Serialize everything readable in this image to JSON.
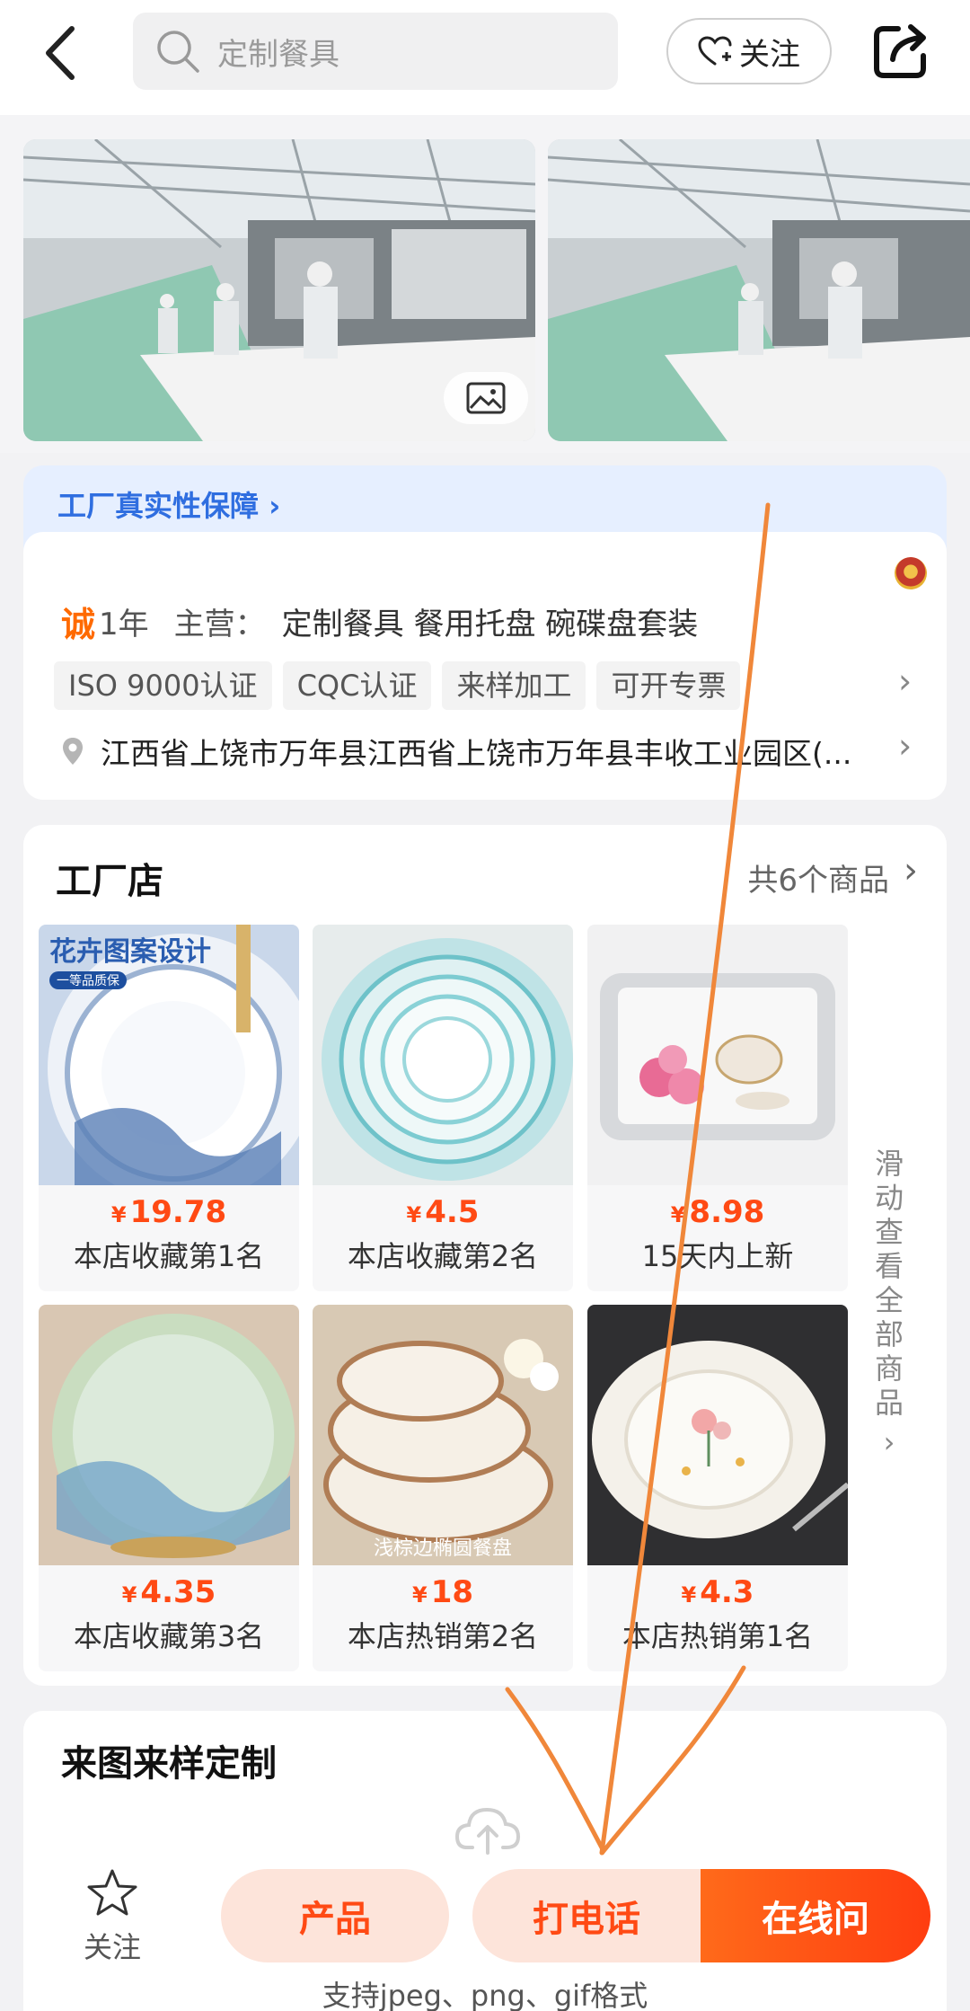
{
  "header": {
    "search_placeholder": "定制餐具",
    "follow_label": "关注"
  },
  "guarantee": {
    "label": "工厂真实性保障 ›"
  },
  "supplier": {
    "cheng": "诚",
    "years": "1年",
    "main_label": "主营：",
    "main_value": "定制餐具 餐用托盘 碗碟盘套装",
    "tags": [
      "ISO 9000认证",
      "CQC认证",
      "来样加工",
      "可开专票"
    ],
    "address": "江西省上饶市万年县江西省上饶市万年县丰收工业园区(..."
  },
  "store": {
    "title": "工厂店",
    "count": "共6个商品",
    "scroll_hint": "滑动查看全部商品",
    "products": [
      {
        "price": "19.78",
        "rank": "本店收藏第1名",
        "img_title": "花卉图案设计",
        "img_badge": "一等品质保"
      },
      {
        "price": "4.5",
        "rank": "本店收藏第2名"
      },
      {
        "price": "8.98",
        "rank": "15天内上新"
      },
      {
        "price": "4.35",
        "rank": "本店收藏第3名"
      },
      {
        "price": "18",
        "rank": "本店热销第2名",
        "img_caption": "浅棕边椭圆餐盘"
      },
      {
        "price": "4.3",
        "rank": "本店热销第1名"
      }
    ],
    "currency": "¥"
  },
  "custom": {
    "title": "来图来样定制",
    "formats": "支持jpeg、png、gif格式"
  },
  "bottom_bar": {
    "follow_label": "关注",
    "product_label": "产品",
    "call_label": "打电话",
    "online_label": "在线问"
  },
  "colors": {
    "accent": "#ff4a14",
    "link": "#2f6ee0",
    "annotation_stroke": "#f0873a"
  }
}
